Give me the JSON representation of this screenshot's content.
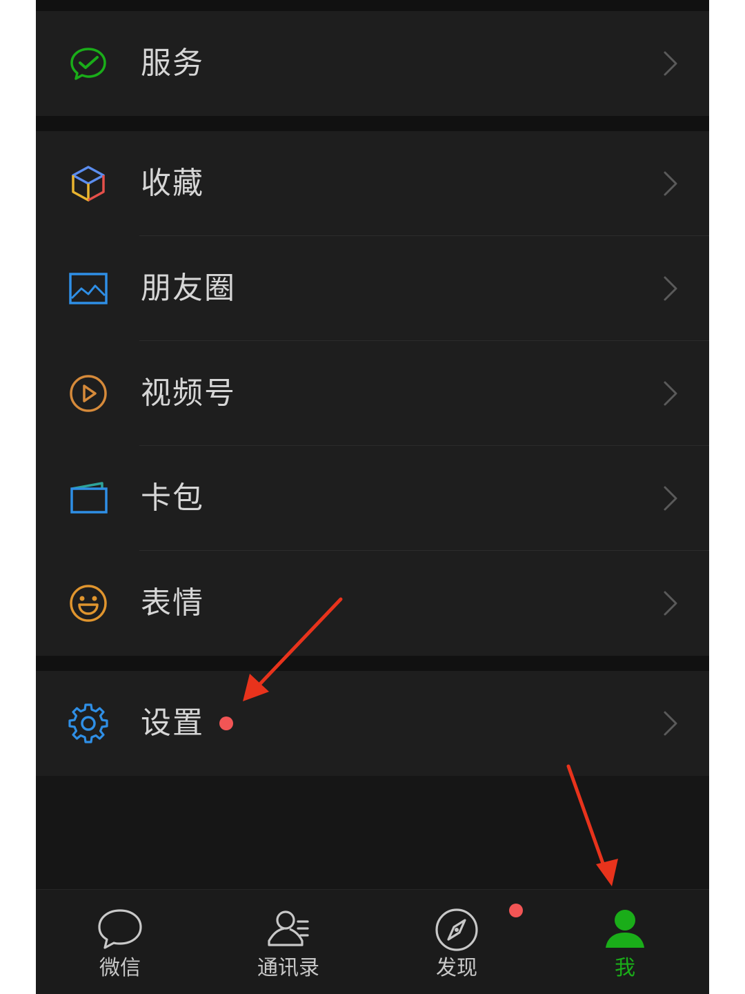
{
  "menu": {
    "items": [
      {
        "label": "服务",
        "icon": "wechat-pay-check-icon",
        "color": "#1aad19"
      },
      {
        "label": "收藏",
        "icon": "cube-icon",
        "color": "#5b8def"
      },
      {
        "label": "朋友圈",
        "icon": "picture-icon",
        "color": "#2f8fe6"
      },
      {
        "label": "视频号",
        "icon": "play-circle-icon",
        "color": "#d68a3a"
      },
      {
        "label": "卡包",
        "icon": "card-wallet-icon",
        "color": "#2f8fe6"
      },
      {
        "label": "表情",
        "icon": "smiley-icon",
        "color": "#e0952e"
      },
      {
        "label": "设置",
        "icon": "gear-icon",
        "color": "#2f8fe6",
        "badge": "red-dot"
      }
    ]
  },
  "tabbar": {
    "tabs": [
      {
        "label": "微信",
        "icon": "chat-bubble-icon"
      },
      {
        "label": "通讯录",
        "icon": "contacts-icon"
      },
      {
        "label": "发现",
        "icon": "compass-icon",
        "badge": "red-dot"
      },
      {
        "label": "我",
        "icon": "person-icon",
        "active": true
      }
    ]
  },
  "colors": {
    "accent": "#1aad19",
    "badge": "#f25555",
    "annotation_arrow": "#e8331c",
    "row_bg": "#1e1e1e",
    "page_bg": "#111111"
  }
}
